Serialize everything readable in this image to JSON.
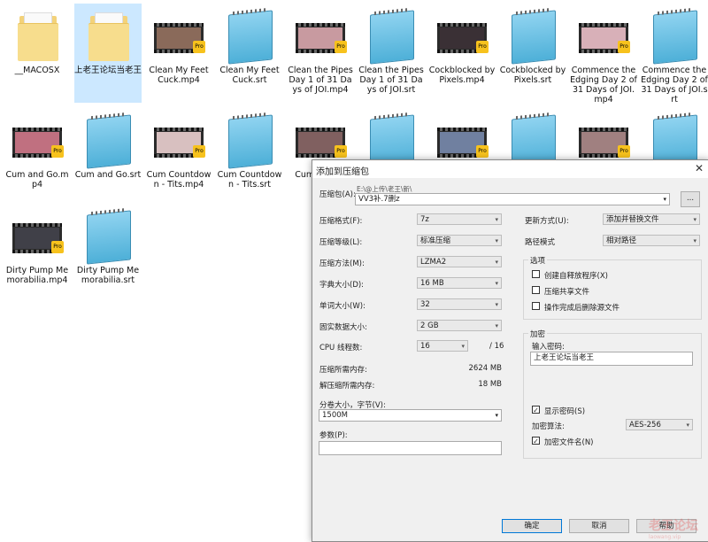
{
  "files": [
    {
      "name": "__MACOSX",
      "type": "folder"
    },
    {
      "name": "上老王论坛当老王",
      "type": "folder",
      "selected": true
    },
    {
      "name": "Clean My Feet Cuck.mp4",
      "type": "video",
      "thumb": "#8a6a5a"
    },
    {
      "name": "Clean My Feet Cuck.srt",
      "type": "srt"
    },
    {
      "name": "Clean the Pipes Day 1 of 31 Days of JOI.mp4",
      "type": "video",
      "thumb": "#c89aa0"
    },
    {
      "name": "Clean the Pipes Day 1 of 31 Days of JOI.srt",
      "type": "srt"
    },
    {
      "name": "Cockblocked by Pixels.mp4",
      "type": "video",
      "thumb": "#3a3035"
    },
    {
      "name": "Cockblocked by Pixels.srt",
      "type": "srt"
    },
    {
      "name": "Commence the Edging Day 2 of 31 Days of JOI.mp4",
      "type": "video",
      "thumb": "#d8b0b8"
    },
    {
      "name": "Commence the Edging Day 2 of 31 Days of JOI.srt",
      "type": "srt"
    },
    {
      "name": "Cum and Go.mp4",
      "type": "video",
      "thumb": "#c07080"
    },
    {
      "name": "Cum and Go.srt",
      "type": "srt"
    },
    {
      "name": "Cum Countdown - Tits.mp4",
      "type": "video",
      "thumb": "#d8c0c0"
    },
    {
      "name": "Cum Countdown - Tits.srt",
      "type": "srt"
    },
    {
      "name": "Cum Ass JOI",
      "type": "video",
      "thumb": "#806060"
    },
    {
      "name": "",
      "type": "srt"
    },
    {
      "name": "",
      "type": "video",
      "thumb": "#7080a0"
    },
    {
      "name": "",
      "type": "srt"
    },
    {
      "name": "",
      "type": "video",
      "thumb": "#a08080"
    },
    {
      "name": "",
      "type": "srt"
    },
    {
      "name": "Dirty Pump Memorabilia.mp4",
      "type": "video",
      "thumb": "#404048"
    },
    {
      "name": "Dirty Pump Memorabilia.srt",
      "type": "srt"
    }
  ],
  "badge_text": "Pro",
  "dialog": {
    "title": "添加到压缩包",
    "close": "✕",
    "archive_label": "压缩包(A):",
    "archive_path": "E:\\@上传\\老王\\新\\",
    "archive_name": "VV3补.7删z",
    "browse": "...",
    "format_label": "压缩格式(F):",
    "format": "7z",
    "level_label": "压缩等级(L):",
    "level": "标准压缩",
    "method_label": "压缩方法(M):",
    "method": "LZMA2",
    "dict_label": "字典大小(D):",
    "dict": "16 MB",
    "word_label": "单词大小(W):",
    "word": "32",
    "solid_label": "固实数据大小:",
    "solid": "2 GB",
    "cpu_label": "CPU 线程数:",
    "cpu": "16",
    "cpu_max": "/ 16",
    "mem_c_label": "压缩所需内存:",
    "mem_c": "2624 MB",
    "mem_d_label": "解压缩所需内存:",
    "mem_d": "18 MB",
    "split_label": "分卷大小，字节(V):",
    "split": "1500M",
    "params_label": "参数(P):",
    "update_label": "更新方式(U):",
    "update": "添加并替换文件",
    "path_label": "路径模式",
    "path": "相对路径",
    "options_title": "选项",
    "opt1": "创建自释放程序(X)",
    "opt2": "压缩共享文件",
    "opt3": "操作完成后删除源文件",
    "enc_title": "加密",
    "pwd_label": "输入密码:",
    "pwd": "上老王论坛当老王",
    "show_pwd": "显示密码(S)",
    "enc_method_label": "加密算法:",
    "enc_method": "AES-256",
    "enc_names": "加密文件名(N)",
    "ok": "确定",
    "cancel": "取消",
    "help": "帮助",
    "check": "✓"
  },
  "watermark": {
    "main": "老王论坛",
    "sub": "laowang.vip"
  }
}
